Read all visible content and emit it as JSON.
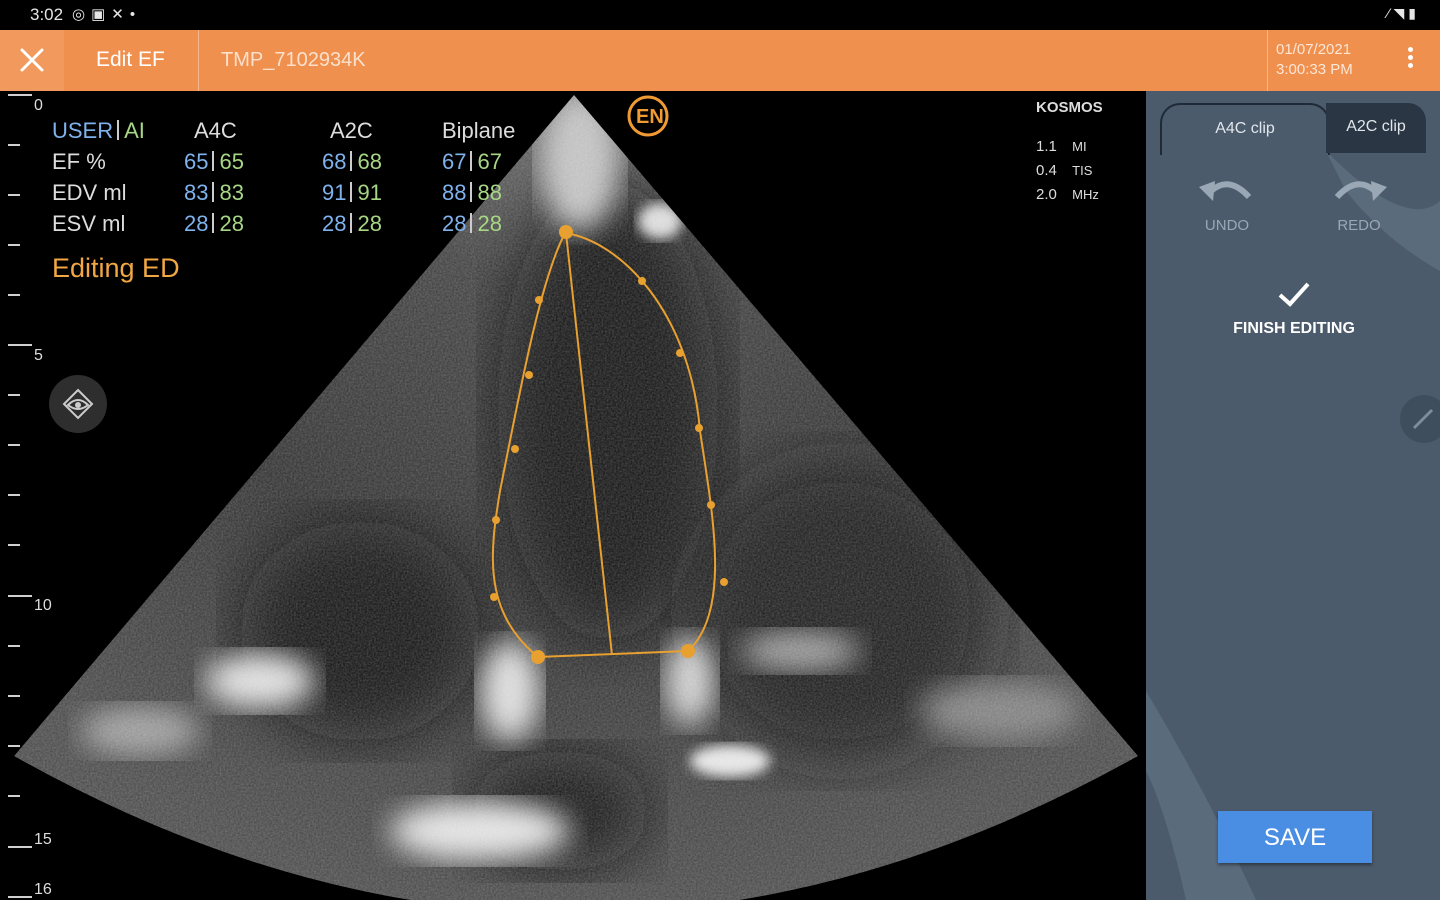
{
  "status_bar": {
    "time": "3:02",
    "left_icons": [
      "location-icon",
      "gallery-icon",
      "crossed-arrows-icon",
      "dot-icon"
    ],
    "right_icons": [
      "edit-icon",
      "wifi-icon",
      "battery-icon"
    ]
  },
  "app_bar": {
    "title": "Edit EF",
    "patient_id": "TMP_7102934K",
    "date": "01/07/2021",
    "time": "3:00:33 PM"
  },
  "measurements": {
    "header": {
      "user": "USER",
      "ai": "AI",
      "col1": "A4C",
      "col2": "A2C",
      "col3": "Biplane"
    },
    "rows": [
      {
        "label": "EF %",
        "a4c_user": "65",
        "a4c_ai": "65",
        "a2c_user": "68",
        "a2c_ai": "68",
        "bip_user": "67",
        "bip_ai": "67"
      },
      {
        "label": "EDV ml",
        "a4c_user": "83",
        "a4c_ai": "83",
        "a2c_user": "91",
        "a2c_ai": "91",
        "bip_user": "88",
        "bip_ai": "88"
      },
      {
        "label": "ESV ml",
        "a4c_user": "28",
        "a4c_ai": "28",
        "a2c_user": "28",
        "a2c_ai": "28",
        "bip_user": "28",
        "bip_ai": "28"
      }
    ]
  },
  "editing_label": "Editing ED",
  "depth_ruler": [
    "0",
    "5",
    "10",
    "15",
    "16"
  ],
  "device": {
    "name": "KOSMOS"
  },
  "params": [
    {
      "value": "1.1",
      "unit": "MI"
    },
    {
      "value": "0.4",
      "unit": "TIS"
    },
    {
      "value": "2.0",
      "unit": "MHz"
    }
  ],
  "panel": {
    "tab_a4c": "A4C clip",
    "tab_a2c": "A2C clip",
    "undo": "UNDO",
    "redo": "REDO",
    "finish": "FINISH EDITING",
    "save": "SAVE"
  },
  "colors": {
    "accent": "#f0904f",
    "panel": "#4b5b6b",
    "contour": "#e8a030",
    "user_value": "#7fb2ec",
    "ai_value": "#a7d685",
    "save": "#4a8ee4"
  }
}
